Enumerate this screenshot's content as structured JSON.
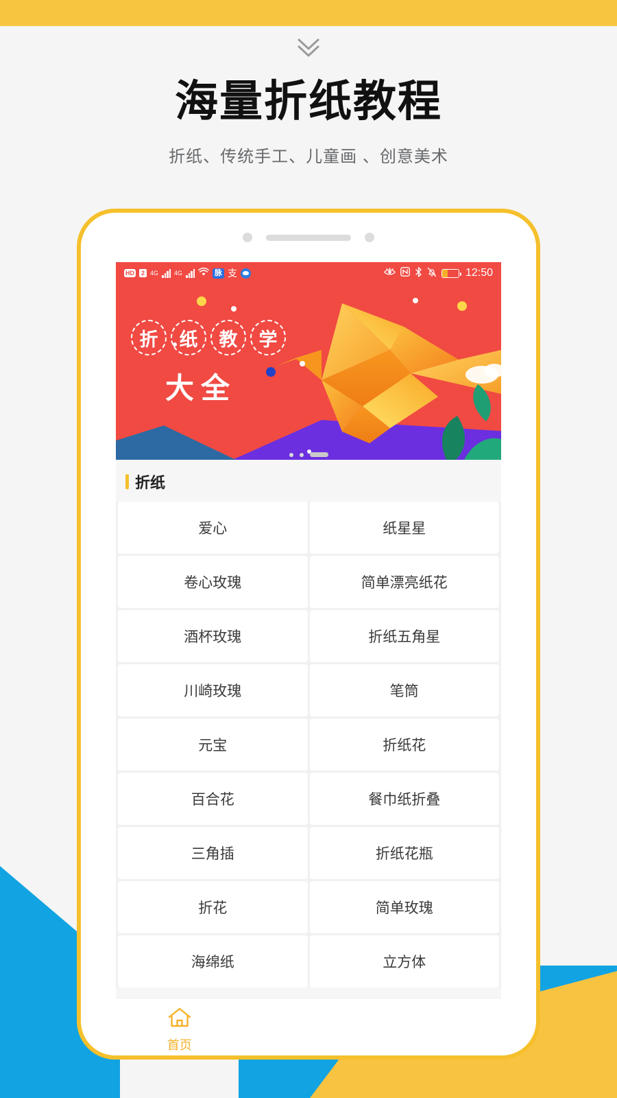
{
  "page": {
    "background_color": "#f5f5f5",
    "accent_yellow": "#f5c02c",
    "accent_blue": "#11a3e2",
    "banner_red": "#f04a43"
  },
  "header": {
    "scroll_hint_icon": "chevron-double-down-icon",
    "title": "海量折纸教程",
    "subtitle": "折纸、传统手工、儿童画 、创意美术"
  },
  "phone": {
    "camera_icon": "camera-dot-icon",
    "speaker_icon": "speaker-grille-icon",
    "status_bar": {
      "hd_label": "HD",
      "sim_label": "2",
      "network_label_1": "4G",
      "network_label_2": "4G",
      "wifi_icon": "wifi-icon",
      "app_badge_1": "脉",
      "app_badge_2": "支",
      "app_badge_3": "browser-icon",
      "eye_comfort_icon": "eye-comfort-icon",
      "nfc_icon": "nfc-icon",
      "bluetooth_icon": "bluetooth-icon",
      "mute_icon": "bell-muted-icon",
      "battery_icon": "battery-icon",
      "time": "12:50"
    },
    "banner": {
      "title_chars": [
        "折",
        "纸",
        "教",
        "学"
      ],
      "subtitle": "大全",
      "illustration": "origami-crane-illustration",
      "pager": {
        "dots": 2,
        "active_index": 2
      }
    },
    "section": {
      "title": "折纸",
      "accent_color": "#f5c02c"
    },
    "grid_items": [
      "爱心",
      "纸星星",
      "卷心玫瑰",
      "简单漂亮纸花",
      "酒杯玫瑰",
      "折纸五角星",
      "川崎玫瑰",
      "笔筒",
      "元宝",
      "折纸花",
      "百合花",
      "餐巾纸折叠",
      "三角插",
      "折纸花瓶",
      "折花",
      "简单玫瑰",
      "海绵纸",
      "立方体"
    ],
    "tabbar": {
      "items": [
        {
          "icon": "home-icon",
          "label": "首页",
          "active": true
        }
      ]
    }
  }
}
